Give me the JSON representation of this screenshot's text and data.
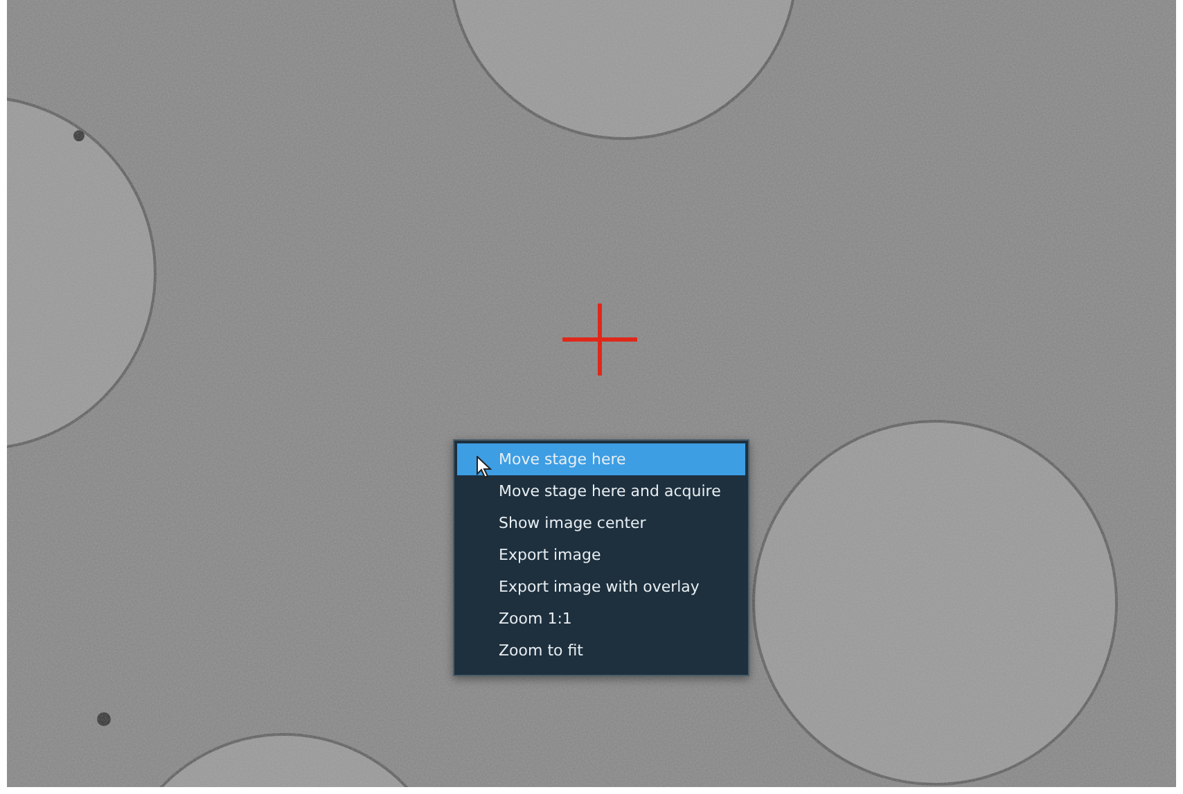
{
  "image_view": {
    "context_menu": {
      "items": [
        {
          "label": "Move stage here",
          "selected": true
        },
        {
          "label": "Move stage here and acquire",
          "selected": false
        },
        {
          "label": "Show image center",
          "selected": false
        },
        {
          "label": "Export image",
          "selected": false
        },
        {
          "label": "Export image with overlay",
          "selected": false
        },
        {
          "label": "Zoom 1:1",
          "selected": false
        },
        {
          "label": "Zoom to fit",
          "selected": false
        }
      ]
    }
  }
}
